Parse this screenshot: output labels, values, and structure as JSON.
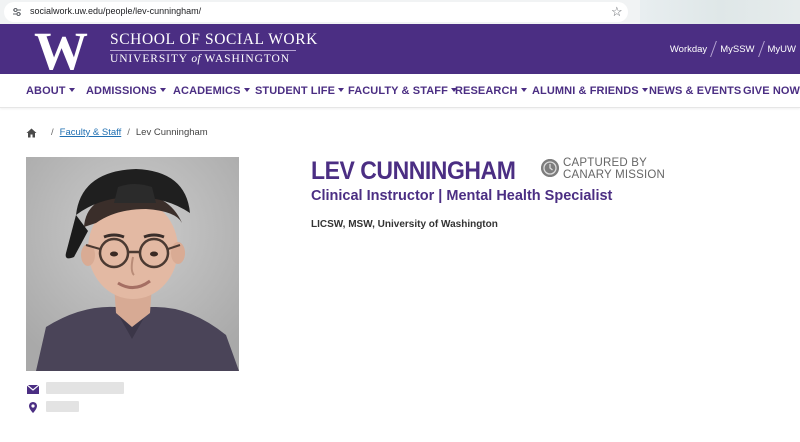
{
  "browser": {
    "url": "socialwork.uw.edu/people/lev-cunningham/"
  },
  "header": {
    "logo_letter": "W",
    "school_name": "SCHOOL OF SOCIAL WORK",
    "university_prefix": "UNIVERSITY",
    "university_of": "of",
    "university_suffix": "WASHINGTON",
    "utility_links": [
      "Workday",
      "MySSW",
      "MyUW"
    ]
  },
  "nav": {
    "items": [
      {
        "label": "ABOUT",
        "dropdown": true
      },
      {
        "label": "ADMISSIONS",
        "dropdown": true
      },
      {
        "label": "ACADEMICS",
        "dropdown": true
      },
      {
        "label": "STUDENT LIFE",
        "dropdown": true
      },
      {
        "label": "FACULTY & STAFF",
        "dropdown": true
      },
      {
        "label": "RESEARCH",
        "dropdown": true
      },
      {
        "label": "ALUMNI & FRIENDS",
        "dropdown": true
      },
      {
        "label": "NEWS & EVENTS",
        "dropdown": false
      },
      {
        "label": "GIVE NOW",
        "dropdown": false
      }
    ]
  },
  "breadcrumb": {
    "home_icon": "home-icon",
    "separator": "/",
    "link": "Faculty & Staff",
    "current": "Lev Cunningham"
  },
  "profile": {
    "name": "LEV CUNNINGHAM",
    "title": "Clinical Instructor | Mental Health Specialist",
    "credentials": "LICSW, MSW, University of Washington",
    "watermark_line1": "CAPTURED BY",
    "watermark_line2": "CANARY MISSION",
    "contact_icons": [
      "envelope-icon",
      "map-pin-icon"
    ]
  },
  "colors": {
    "uw_purple": "#4b2e83",
    "link_blue": "#1f6fb2",
    "redaction_gray": "#e3e3e3"
  }
}
